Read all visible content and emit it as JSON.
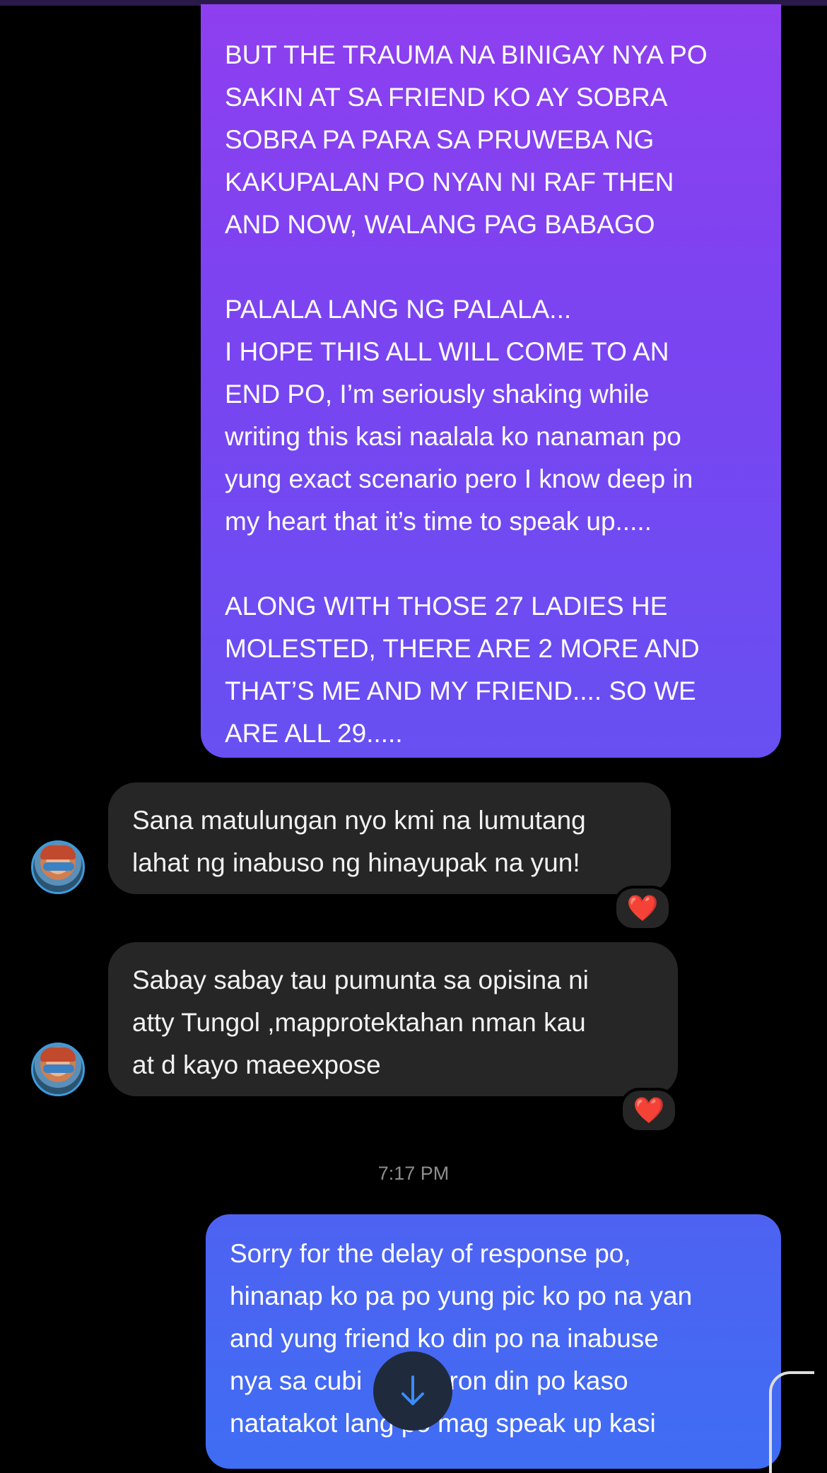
{
  "conversation": {
    "outgoing_1": {
      "lines": [
        "BUT THE TRAUMA NA BINIGAY NYA PO",
        "SAKIN AT SA FRIEND KO AY SOBRA",
        "SOBRA PA PARA SA PRUWEBA NG",
        "KAKUPALAN PO NYAN NI RAF THEN",
        "AND NOW, WALANG PAG BABAGO",
        "",
        "PALALA LANG NG PALALA...",
        "I HOPE THIS ALL WILL COME TO AN",
        "END PO, I’m seriously shaking while",
        "writing this kasi naalala ko nanaman po",
        "yung exact scenario pero I know deep in",
        "my heart that it’s time to speak up.....",
        "",
        "ALONG WITH THOSE 27 LADIES HE",
        "MOLESTED, THERE ARE 2 MORE AND",
        "THAT’S ME AND MY FRIEND.... SO WE",
        "ARE ALL 29....."
      ]
    },
    "incoming_1": {
      "lines": [
        "Sana matulungan nyo kmi na lumutang",
        "lahat ng inabuso ng hinayupak na yun!"
      ],
      "reaction": "❤️"
    },
    "incoming_2": {
      "lines": [
        "Sabay sabay tau pumunta sa opisina ni",
        "atty Tungol ,mapprotektahan nman kau",
        "at d kayo maeexpose"
      ],
      "reaction": "❤️"
    },
    "timestamp": "7:17 PM",
    "outgoing_2": {
      "lines": [
        "Sorry for the delay of response po,",
        "hinanap ko pa po yung pic ko po na yan",
        "and yung friend ko din po na inabuse",
        "nya sa cubi          eron din po kaso",
        "natatakot lang po mag speak up kasi"
      ]
    },
    "scroll_button_icon": "arrow-down-icon",
    "colors": {
      "outgoing_gradient_top": "#8e3ff0",
      "outgoing_gradient_bottom": "#4e62f2",
      "incoming_bubble": "#262626",
      "reaction_heart": "#ff2d3f",
      "background": "#000000"
    }
  }
}
